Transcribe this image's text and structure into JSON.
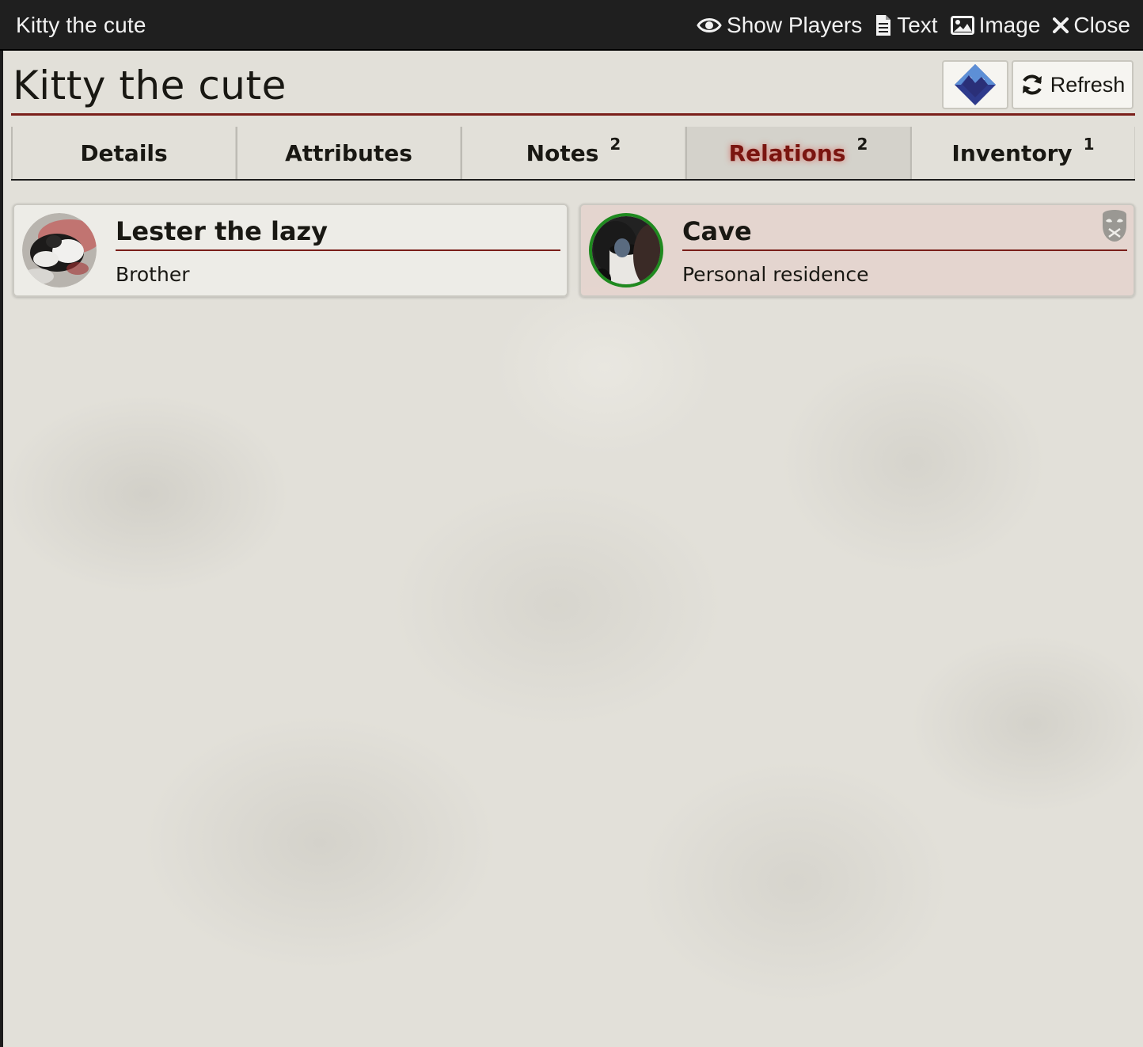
{
  "window": {
    "title": "Kitty the cute",
    "controls": {
      "show_players": "Show Players",
      "text": "Text",
      "image": "Image",
      "close": "Close"
    }
  },
  "sheet": {
    "title": "Kitty the cute",
    "refresh_label": "Refresh",
    "logo_icon": "mountain-diamond-icon"
  },
  "tabs": [
    {
      "label": "Details",
      "badge": ""
    },
    {
      "label": "Attributes",
      "badge": ""
    },
    {
      "label": "Notes",
      "badge": "2"
    },
    {
      "label": "Relations",
      "badge": "2",
      "active": true
    },
    {
      "label": "Inventory",
      "badge": "1"
    }
  ],
  "relations": [
    {
      "name": "Lester the lazy",
      "relation": "Brother"
    },
    {
      "name": "Cave",
      "relation": "Personal residence",
      "icon": "mask-icon"
    }
  ],
  "colors": {
    "accent": "#7a1f1a",
    "active_tab": "#7a1510",
    "avatar_ring": "#1f8a1f"
  }
}
